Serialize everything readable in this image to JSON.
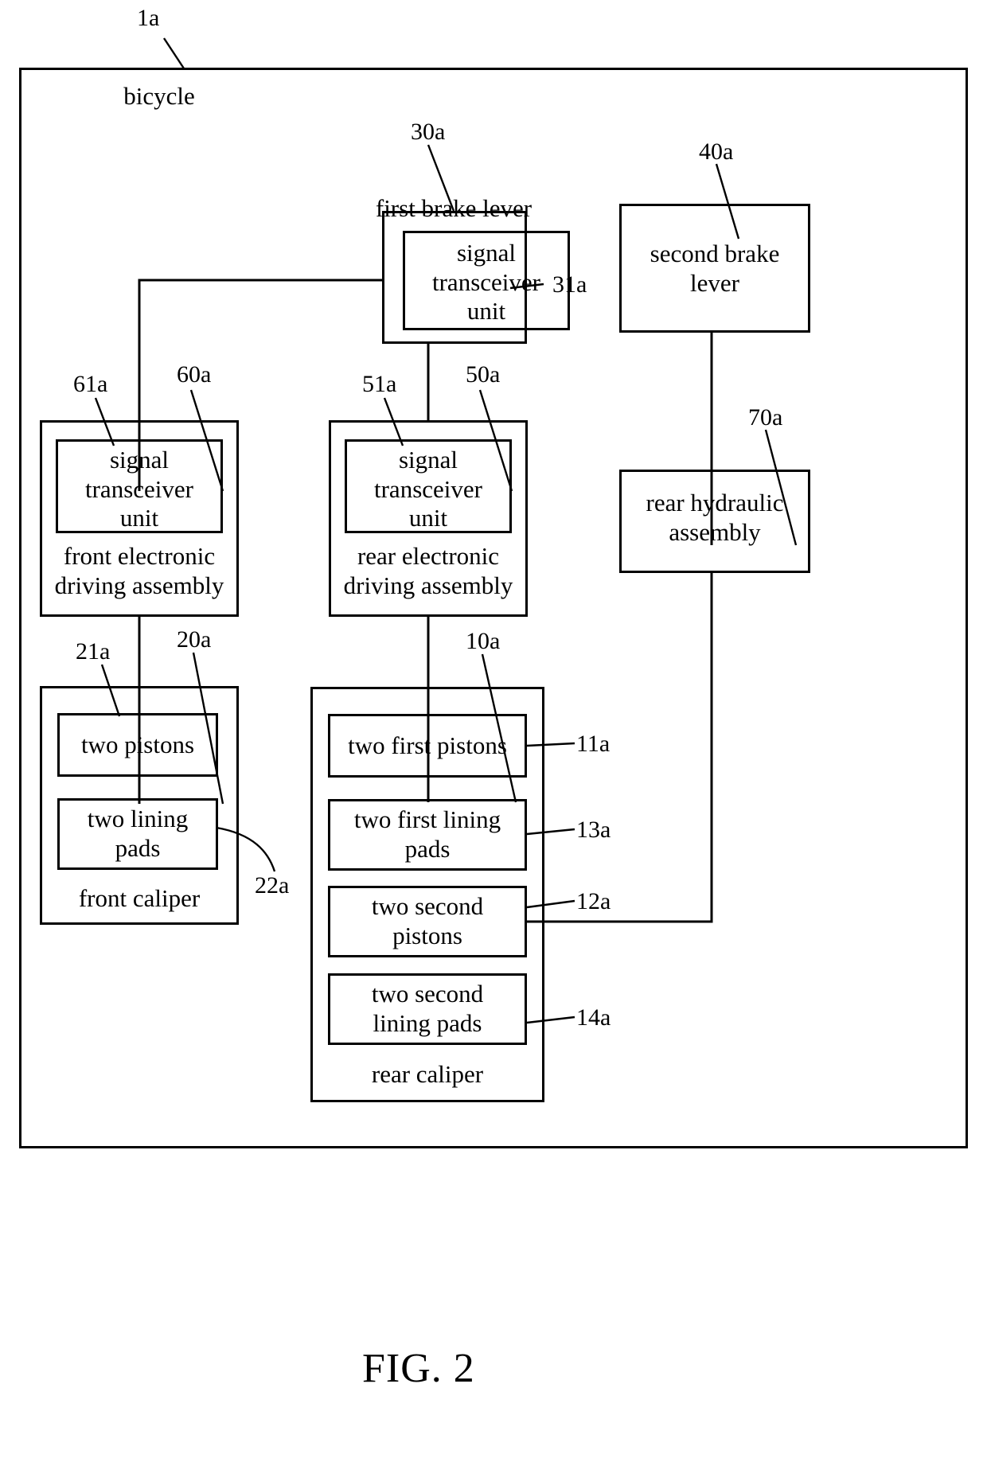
{
  "figure": {
    "caption": "FIG. 2",
    "outer_ref": "1a",
    "outer_label": "bicycle"
  },
  "boxes": {
    "bicycle": {
      "label": "bicycle",
      "ref": "1a"
    },
    "first_brake_lever": {
      "label": "first brake lever",
      "ref": "30a"
    },
    "first_brake_lever_transceiver": {
      "label": "signal\ntransceiver\nunit",
      "ref": "31a"
    },
    "second_brake_lever": {
      "label": "second brake\nlever",
      "ref": "40a"
    },
    "front_driving_assembly": {
      "label": "front electronic\ndriving assembly",
      "ref": "60a"
    },
    "front_transceiver": {
      "label": "signal\ntransceiver\nunit",
      "ref": "61a"
    },
    "rear_driving_assembly": {
      "label": "rear electronic\ndriving assembly",
      "ref": "50a"
    },
    "rear_transceiver": {
      "label": "signal\ntransceiver\nunit",
      "ref": "51a"
    },
    "rear_hydraulic_assembly": {
      "label": "rear hydraulic\nassembly",
      "ref": "70a"
    },
    "front_caliper": {
      "label": "front caliper",
      "ref": "20a"
    },
    "front_pistons": {
      "label": "two pistons",
      "ref": "21a"
    },
    "front_lining_pads": {
      "label": "two lining\npads",
      "ref": "22a"
    },
    "rear_caliper": {
      "label": "rear caliper",
      "ref": "10a"
    },
    "rear_first_pistons": {
      "label": "two first pistons",
      "ref": "11a"
    },
    "rear_first_lining_pads": {
      "label": "two first lining\npads",
      "ref": "13a"
    },
    "rear_second_pistons": {
      "label": "two second\npistons",
      "ref": "12a"
    },
    "rear_second_lining_pads": {
      "label": "two second\nlining pads",
      "ref": "14a"
    }
  },
  "colors": {
    "line": "#000000",
    "background": "#ffffff"
  }
}
